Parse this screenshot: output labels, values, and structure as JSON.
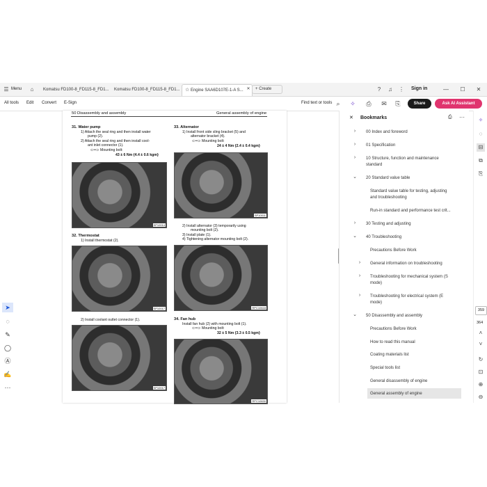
{
  "tabs": {
    "menu_label": "Menu",
    "items": [
      {
        "label": "Komatsu FD100-8_FD115-8_FD1..."
      },
      {
        "label": "Komatsu FD100-8_FD115-8_FD1..."
      },
      {
        "label": "Engine SAA6D107E-1-A S..."
      }
    ],
    "create_label": "Create",
    "sign_in_label": "Sign in"
  },
  "toolbar": {
    "all_tools": "All tools",
    "edit": "Edit",
    "convert": "Convert",
    "esign": "E-Sign",
    "find_text": "Find text or tools",
    "share": "Share",
    "ask_ai": "Ask AI Assistant"
  },
  "document": {
    "header_left": "50 Disassembly and assembly",
    "header_right": "General assembly of engine",
    "sections": {
      "s31_title": "31.   Water pump",
      "s31_line1": "1)    Attach the seal ring and then install water",
      "s31_line1b": "pump (2).",
      "s31_line2": "2)    Attach the seal ring and then install cool-",
      "s31_line2b": "ant inlet connector (1).",
      "s31_bolt": "Mounting bolt:",
      "s31_torque": "43 ± 6 Nm {4.4 ± 0.6 kgm}",
      "s32_title": "32.   Thermostat",
      "s32_line1": "1)    Install thermostat (2).",
      "s32_line2": "2)    Install coolant outlet connector (1).",
      "s33_title": "33.   Alternator",
      "s33_line1": "1)    Install front side sling bracket (5) and",
      "s33_line1b": "alternator bracket (4).",
      "s33_bolt": "Mounting bolt:",
      "s33_torque": "24 ± 4 Nm {2.4 ± 0.4 kgm}",
      "s33_line2": "2)    Install alternator (3) temporarily using",
      "s33_line2b": "mounting bolt (2).",
      "s33_line3": "3)    Install plate (1).",
      "s33_line4": "4)    Tightening alternator mounting bolt (2).",
      "s34_title": "34.   Fan hub",
      "s34_line1": "Install fan hub (2) with mounting bolt (1).",
      "s34_bolt": "Mounting bolt:",
      "s34_torque": "32 ± 5 Nm {3.3 ± 0.5 kgm}"
    },
    "photo_tags": [
      "SP10014",
      "SP10017",
      "SP10017",
      "SP10011",
      "RPC10618",
      "RPC10630"
    ]
  },
  "bookmarks": {
    "title": "Bookmarks",
    "items": [
      {
        "label": "00 Index and foreword"
      },
      {
        "label": "01 Specification"
      },
      {
        "label": "10 Structure, function and maintenance"
      },
      {
        "label": "standard"
      },
      {
        "label": "20 Standard value table"
      },
      {
        "label": "Standard value table for testing, adjusting"
      },
      {
        "label": "and troubleshooting"
      },
      {
        "label": "Run-in standard and performance test crit..."
      },
      {
        "label": "30 Testing and adjusting"
      },
      {
        "label": "40 Troubleshooting"
      },
      {
        "label": "Precautions Before Work"
      },
      {
        "label": "General information on troubleshooting"
      },
      {
        "label": "Troubleshooting for mechanical system (S"
      },
      {
        "label": "mode)"
      },
      {
        "label": "Troubleshooting for electrical system (E"
      },
      {
        "label": "mode)"
      },
      {
        "label": "50 Disassembly and assembly"
      },
      {
        "label": "Precautions Before Work"
      },
      {
        "label": "How to read this manual"
      },
      {
        "label": "Coating materials list"
      },
      {
        "label": "Special tools list"
      },
      {
        "label": "General disassembly of engine"
      },
      {
        "label": "General assembly of engine"
      }
    ]
  },
  "page_nav": {
    "current": "359",
    "total": "364"
  }
}
